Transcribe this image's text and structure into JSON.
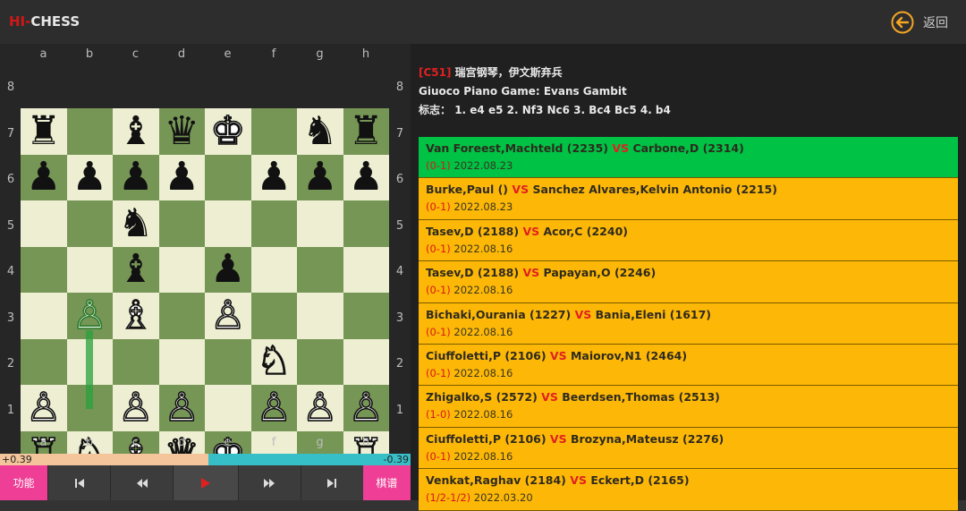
{
  "header": {
    "logo_hi": "HI-",
    "logo_chess": "CHESS",
    "back_label": "返回"
  },
  "board": {
    "files": [
      "a",
      "b",
      "c",
      "d",
      "e",
      "f",
      "g",
      "h"
    ],
    "ranks": [
      "8",
      "7",
      "6",
      "5",
      "4",
      "3",
      "2",
      "1"
    ],
    "rows": [
      [
        [
          "b",
          "♜"
        ],
        null,
        [
          "b",
          "♝"
        ],
        [
          "b",
          "♛"
        ],
        [
          "w",
          "♚"
        ],
        null,
        [
          "b",
          "♞"
        ],
        [
          "b",
          "♜"
        ]
      ],
      [
        [
          "b",
          "♟"
        ],
        [
          "b",
          "♟"
        ],
        [
          "b",
          "♟"
        ],
        [
          "b",
          "♟"
        ],
        null,
        [
          "b",
          "♟"
        ],
        [
          "b",
          "♟"
        ],
        [
          "b",
          "♟"
        ]
      ],
      [
        null,
        null,
        [
          "b",
          "♞"
        ],
        null,
        null,
        null,
        null,
        null
      ],
      [
        null,
        null,
        [
          "b",
          "♝"
        ],
        null,
        [
          "b",
          "♟"
        ],
        null,
        null,
        null
      ],
      [
        null,
        [
          "g",
          "♙"
        ],
        [
          "w",
          "♗"
        ],
        null,
        [
          "w",
          "♙"
        ],
        null,
        null,
        null
      ],
      [
        null,
        null,
        null,
        null,
        null,
        [
          "w",
          "♘"
        ],
        null,
        null
      ],
      [
        [
          "w",
          "♙"
        ],
        null,
        [
          "w",
          "♙"
        ],
        [
          "w",
          "♙"
        ],
        null,
        [
          "w",
          "♙"
        ],
        [
          "w",
          "♙"
        ],
        [
          "w",
          "♙"
        ]
      ],
      [
        [
          "w",
          "♖"
        ],
        [
          "w",
          "♘"
        ],
        [
          "w",
          "♗"
        ],
        [
          "w",
          "♕"
        ],
        [
          "w",
          "♚"
        ],
        null,
        null,
        [
          "w",
          "♖"
        ]
      ]
    ]
  },
  "eval": {
    "white_text": "+0.39",
    "black_text": "-0.39",
    "white_fraction": 0.508
  },
  "controls": {
    "func_label": "功能",
    "book_label": "棋谱",
    "first": "first-move",
    "prev": "prev-move",
    "play": "play",
    "next": "next-move",
    "last": "last-move"
  },
  "opening": {
    "eco": "[C51]",
    "name_cn": "瑞宫钢琴，伊文斯弃兵",
    "name_en": "Giuoco Piano Game: Evans Gambit",
    "moves_label": "标志：",
    "moves": "1. e4 e5 2. Nf3 Nc6 3. Bc4 Bc5 4. b4"
  },
  "games": [
    {
      "white": "Van Foreest,Machteld (2235)",
      "black": "Carbone,D (2314)",
      "result": "(0-1)",
      "date": "2022.08.23",
      "selected": true
    },
    {
      "white": "Burke,Paul ()",
      "black": "Sanchez Alvares,Kelvin Antonio (2215)",
      "result": "(0-1)",
      "date": "2022.08.23",
      "selected": false
    },
    {
      "white": "Tasev,D (2188)",
      "black": "Acor,C (2240)",
      "result": "(0-1)",
      "date": "2022.08.16",
      "selected": false
    },
    {
      "white": "Tasev,D (2188)",
      "black": "Papayan,O (2246)",
      "result": "(0-1)",
      "date": "2022.08.16",
      "selected": false
    },
    {
      "white": "Bichaki,Ourania (1227)",
      "black": "Bania,Eleni (1617)",
      "result": "(0-1)",
      "date": "2022.08.16",
      "selected": false
    },
    {
      "white": "Ciuffoletti,P (2106)",
      "black": "Maiorov,N1 (2464)",
      "result": "(0-1)",
      "date": "2022.08.16",
      "selected": false
    },
    {
      "white": "Zhigalko,S (2572)",
      "black": "Beerdsen,Thomas (2513)",
      "result": "(1-0)",
      "date": "2022.08.16",
      "selected": false
    },
    {
      "white": "Ciuffoletti,P (2106)",
      "black": "Brozyna,Mateusz (2276)",
      "result": "(0-1)",
      "date": "2022.08.16",
      "selected": false
    },
    {
      "white": "Venkat,Raghav (2184)",
      "black": "Eckert,D (2165)",
      "result": "(1/2-1/2)",
      "date": "2022.03.20",
      "selected": false
    }
  ],
  "vs_label": "VS",
  "colors": {
    "green_row": "#00c244",
    "yellow_row": "#fdb807",
    "accent_red": "#e02020",
    "back_icon": "#f5a623"
  }
}
